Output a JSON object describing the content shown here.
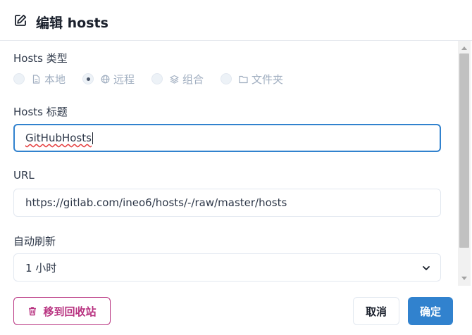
{
  "dialog": {
    "title": "编辑 hosts",
    "title_icon": "edit-icon"
  },
  "hosts_type": {
    "label": "Hosts 类型",
    "selected": "远程",
    "options": [
      {
        "label": "本地",
        "icon": "file-icon"
      },
      {
        "label": "远程",
        "icon": "globe-icon"
      },
      {
        "label": "组合",
        "icon": "layers-icon"
      },
      {
        "label": "文件夹",
        "icon": "folder-icon"
      }
    ]
  },
  "hosts_title": {
    "label": "Hosts 标题",
    "value": "GitHubHosts"
  },
  "url": {
    "label": "URL",
    "value": "https://gitlab.com/ineo6/hosts/-/raw/master/hosts"
  },
  "auto_refresh": {
    "label": "自动刷新",
    "value": "1 小时"
  },
  "footer": {
    "trash_label": "移到回收站",
    "cancel_label": "取消",
    "ok_label": "确定"
  },
  "colors": {
    "accent": "#3182ce",
    "danger": "#b83280"
  }
}
